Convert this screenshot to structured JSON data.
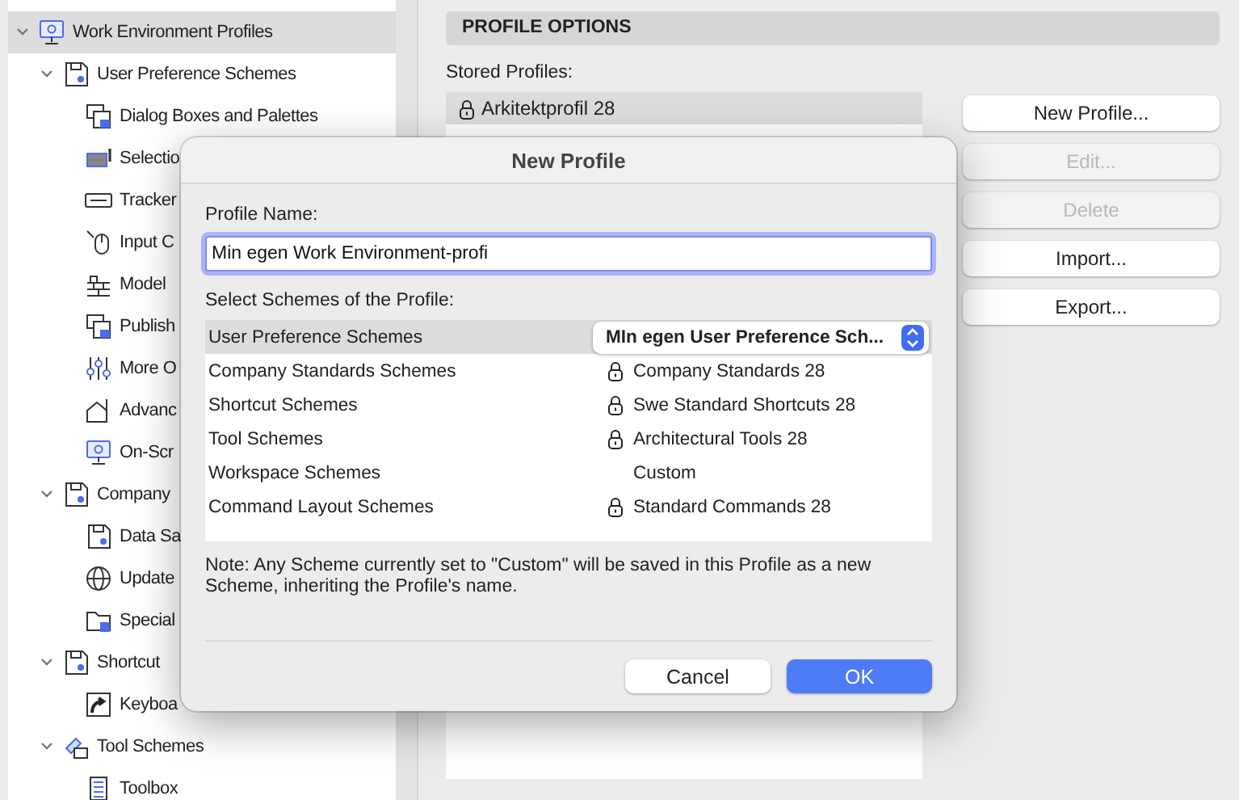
{
  "sidebar": {
    "items": [
      {
        "label": "Work Environment Profiles",
        "selected": true,
        "expanded": true,
        "children": [
          {
            "label": "User Preference Schemes",
            "selected": false,
            "expanded": true,
            "children": [
              {
                "label": "Dialog Boxes and Palettes",
                "selected": false
              },
              {
                "label": "Selectio",
                "selected": false
              },
              {
                "label": "Tracker",
                "selected": false
              },
              {
                "label": "Input C",
                "selected": false
              },
              {
                "label": "Model",
                "selected": false
              },
              {
                "label": "Publish",
                "selected": false
              },
              {
                "label": "More O",
                "selected": false
              },
              {
                "label": "Advanc",
                "selected": false
              },
              {
                "label": "On-Scr",
                "selected": false
              }
            ]
          },
          {
            "label": "Company",
            "selected": false,
            "expanded": true,
            "children": [
              {
                "label": "Data Sa",
                "selected": false
              },
              {
                "label": "Update",
                "selected": false
              },
              {
                "label": "Special",
                "selected": false
              }
            ]
          },
          {
            "label": "Shortcut",
            "selected": false,
            "expanded": true,
            "children": [
              {
                "label": "Keyboa",
                "selected": false
              }
            ]
          },
          {
            "label": "Tool Schemes",
            "selected": false,
            "expanded": true,
            "children": [
              {
                "label": "Toolbox",
                "selected": false
              }
            ]
          }
        ]
      }
    ]
  },
  "profile_options": {
    "title": "PROFILE OPTIONS",
    "stored_label": "Stored Profiles:",
    "profiles": [
      {
        "name": "Arkitektprofil 28",
        "locked": true,
        "selected": true
      }
    ],
    "buttons": [
      {
        "label": "New Profile...",
        "disabled": false
      },
      {
        "label": "Edit...",
        "disabled": true
      },
      {
        "label": "Delete",
        "disabled": true
      },
      {
        "label": "Import...",
        "disabled": false
      },
      {
        "label": "Export...",
        "disabled": false
      }
    ]
  },
  "dialog": {
    "title": "New Profile",
    "name_label": "Profile Name:",
    "name_value": "Min egen Work Environment-profi",
    "schemes_label": "Select Schemes of the Profile:",
    "schemes": [
      {
        "scheme": "User Preference Schemes",
        "value": "MIn egen User Preference Sch...",
        "kind": "popup",
        "locked": false,
        "selected": true
      },
      {
        "scheme": "Company Standards Schemes",
        "value": "Company Standards 28",
        "kind": "text",
        "locked": true,
        "selected": false
      },
      {
        "scheme": "Shortcut Schemes",
        "value": "Swe Standard Shortcuts 28",
        "kind": "text",
        "locked": true,
        "selected": false
      },
      {
        "scheme": "Tool Schemes",
        "value": "Architectural Tools 28",
        "kind": "text",
        "locked": true,
        "selected": false
      },
      {
        "scheme": "Workspace Schemes",
        "value": "Custom",
        "kind": "text",
        "locked": false,
        "selected": false
      },
      {
        "scheme": "Command Layout Schemes",
        "value": "Standard Commands 28",
        "kind": "text",
        "locked": true,
        "selected": false
      }
    ],
    "note": "Note: Any Scheme currently set to \"Custom\" will be saved in this Profile as a new Scheme, inheriting the Profile's name.",
    "buttons": [
      {
        "label": "Cancel",
        "default": false
      },
      {
        "label": "OK",
        "default": true
      }
    ]
  }
}
